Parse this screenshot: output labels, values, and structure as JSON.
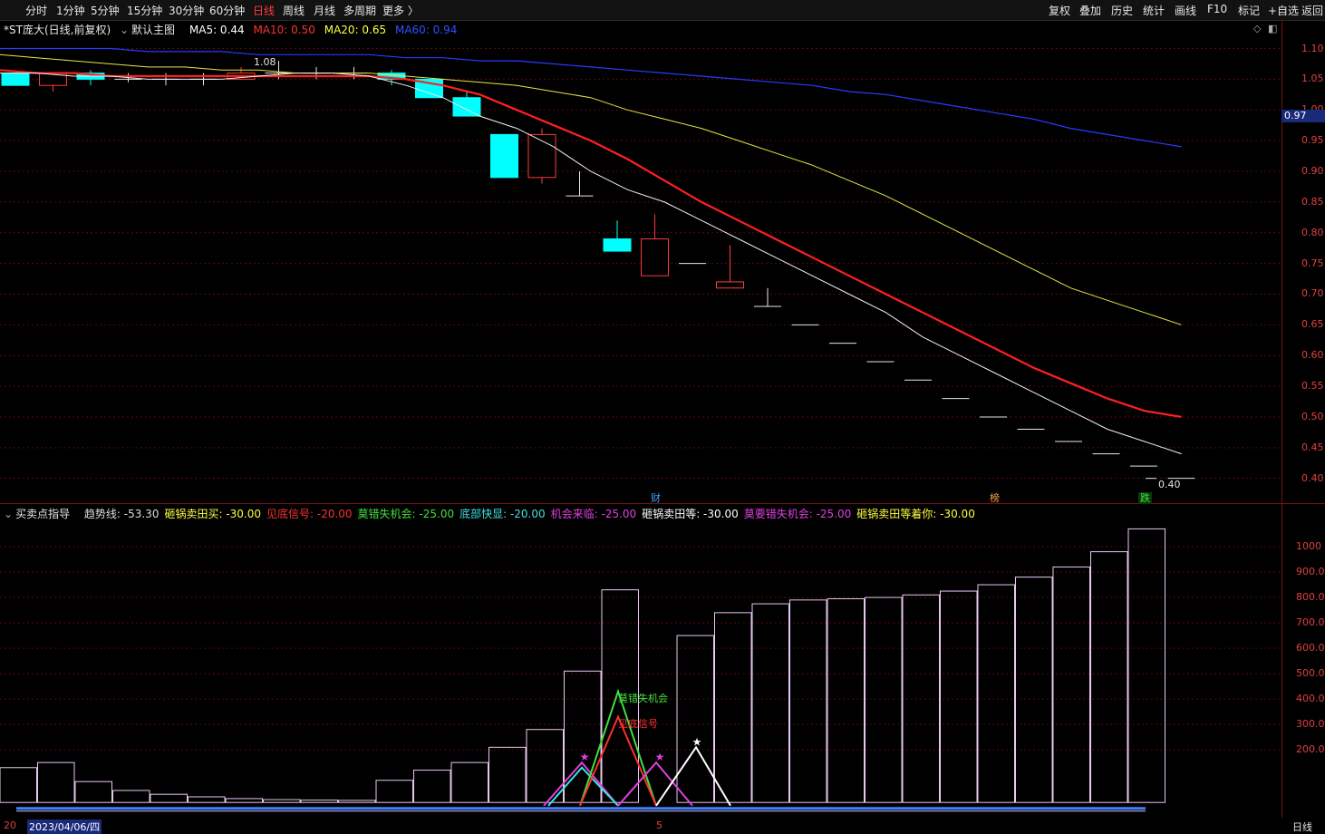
{
  "toolbar": {
    "periods": [
      "分时",
      "1分钟",
      "5分钟",
      "15分钟",
      "30分钟",
      "60分钟",
      "日线",
      "周线",
      "月线",
      "多周期",
      "更多 〉"
    ],
    "active_period": "日线",
    "right_buttons": [
      "复权",
      "叠加",
      "历史",
      "统计",
      "画线",
      "F10",
      "标记",
      "+自选",
      "返回"
    ]
  },
  "main": {
    "title": "*ST庞大(日线,前复权)",
    "indicator_toggle": "默认主图",
    "ma5_label": "MA5: 0.44",
    "ma10_label": "MA10: 0.50",
    "ma20_label": "MA20: 0.65",
    "ma60_label": "MA60: 0.94",
    "current_price_tag": "0.97",
    "high_annotation": "1.08",
    "low_annotation": "0.40",
    "events": {
      "cai": "财",
      "bang": "榜",
      "die": "跌"
    }
  },
  "sub": {
    "indicator_name": "买卖点指导",
    "items": [
      {
        "label": "趋势线: -53.30",
        "color": "#dddddd"
      },
      {
        "label": "砸锅卖田买: -30.00",
        "color": "#ffff40"
      },
      {
        "label": "见底信号: -20.00",
        "color": "#ff3030"
      },
      {
        "label": "莫错失机会: -25.00",
        "color": "#40e040"
      },
      {
        "label": "底部快显: -20.00",
        "color": "#40e0e0"
      },
      {
        "label": "机会来临: -25.00",
        "color": "#e040e0"
      },
      {
        "label": "砸锅卖田等: -30.00",
        "color": "#ffffff"
      },
      {
        "label": "莫要错失机会: -25.00",
        "color": "#e040e0"
      },
      {
        "label": "砸锅卖田等着你: -30.00",
        "color": "#ffff40"
      }
    ],
    "annot_green": "莫错失机会",
    "annot_red": "见底信号"
  },
  "axis": {
    "price_ticks": [
      "1.10",
      "1.05",
      "1.00",
      "0.95",
      "0.90",
      "0.85",
      "0.80",
      "0.75",
      "0.70",
      "0.65",
      "0.60",
      "0.55",
      "0.50",
      "0.45",
      "0.40"
    ],
    "sub_ticks": [
      "1000",
      "900.0",
      "800.0",
      "700.0",
      "600.0",
      "500.0",
      "400.0",
      "300.0",
      "200.0"
    ]
  },
  "bottom": {
    "date_label": "2023/04/06/四",
    "date_prefix": "20",
    "mid_marker": "5",
    "period_label": "日线"
  },
  "chart_data": {
    "type": "candlestick",
    "ylim": [
      0.37,
      1.12
    ],
    "candles": [
      {
        "o": 1.04,
        "c": 1.06,
        "h": 1.06,
        "l": 1.04,
        "up": false
      },
      {
        "o": 1.04,
        "c": 1.06,
        "h": 1.06,
        "l": 1.03,
        "up": true
      },
      {
        "o": 1.05,
        "c": 1.06,
        "h": 1.065,
        "l": 1.04,
        "up": false
      },
      {
        "o": 1.05,
        "c": 1.05,
        "h": 1.06,
        "l": 1.045,
        "up": true
      },
      {
        "o": 1.05,
        "c": 1.05,
        "h": 1.06,
        "l": 1.04,
        "up": true
      },
      {
        "o": 1.05,
        "c": 1.05,
        "h": 1.06,
        "l": 1.04,
        "up": true
      },
      {
        "o": 1.05,
        "c": 1.06,
        "h": 1.07,
        "l": 1.05,
        "up": true
      },
      {
        "o": 1.06,
        "c": 1.06,
        "h": 1.08,
        "l": 1.05,
        "up": true
      },
      {
        "o": 1.06,
        "c": 1.06,
        "h": 1.07,
        "l": 1.05,
        "up": true
      },
      {
        "o": 1.06,
        "c": 1.06,
        "h": 1.07,
        "l": 1.05,
        "up": true
      },
      {
        "o": 1.06,
        "c": 1.05,
        "h": 1.065,
        "l": 1.04,
        "up": false
      },
      {
        "o": 1.05,
        "c": 1.02,
        "h": 1.05,
        "l": 1.02,
        "up": false
      },
      {
        "o": 1.02,
        "c": 0.99,
        "h": 1.03,
        "l": 0.99,
        "up": false
      },
      {
        "o": 0.96,
        "c": 0.89,
        "h": 0.96,
        "l": 0.89,
        "up": false
      },
      {
        "o": 0.89,
        "c": 0.96,
        "h": 0.97,
        "l": 0.88,
        "up": true
      },
      {
        "o": 0.86,
        "c": 0.86,
        "h": 0.9,
        "l": 0.86,
        "up": true
      },
      {
        "o": 0.79,
        "c": 0.77,
        "h": 0.82,
        "l": 0.77,
        "up": false
      },
      {
        "o": 0.73,
        "c": 0.79,
        "h": 0.83,
        "l": 0.73,
        "up": true
      },
      {
        "o": 0.75,
        "c": 0.75,
        "h": 0.75,
        "l": 0.75,
        "up": true
      },
      {
        "o": 0.71,
        "c": 0.72,
        "h": 0.78,
        "l": 0.71,
        "up": true
      },
      {
        "o": 0.68,
        "c": 0.68,
        "h": 0.71,
        "l": 0.68,
        "up": true
      },
      {
        "o": 0.65,
        "c": 0.65,
        "h": 0.65,
        "l": 0.65,
        "up": true
      },
      {
        "o": 0.62,
        "c": 0.62,
        "h": 0.62,
        "l": 0.62,
        "up": true
      },
      {
        "o": 0.59,
        "c": 0.59,
        "h": 0.59,
        "l": 0.59,
        "up": true
      },
      {
        "o": 0.56,
        "c": 0.56,
        "h": 0.56,
        "l": 0.56,
        "up": true
      },
      {
        "o": 0.53,
        "c": 0.53,
        "h": 0.53,
        "l": 0.53,
        "up": true
      },
      {
        "o": 0.5,
        "c": 0.5,
        "h": 0.5,
        "l": 0.5,
        "up": true
      },
      {
        "o": 0.48,
        "c": 0.48,
        "h": 0.48,
        "l": 0.48,
        "up": true
      },
      {
        "o": 0.46,
        "c": 0.46,
        "h": 0.46,
        "l": 0.46,
        "up": true
      },
      {
        "o": 0.44,
        "c": 0.44,
        "h": 0.44,
        "l": 0.44,
        "up": true
      },
      {
        "o": 0.42,
        "c": 0.42,
        "h": 0.42,
        "l": 0.42,
        "up": true
      },
      {
        "o": 0.4,
        "c": 0.4,
        "h": 0.4,
        "l": 0.4,
        "up": true
      }
    ],
    "ma5": [
      1.06,
      1.06,
      1.055,
      1.055,
      1.05,
      1.05,
      1.05,
      1.055,
      1.06,
      1.06,
      1.055,
      1.04,
      1.02,
      0.99,
      0.97,
      0.94,
      0.9,
      0.87,
      0.85,
      0.82,
      0.79,
      0.76,
      0.73,
      0.7,
      0.67,
      0.63,
      0.6,
      0.57,
      0.54,
      0.51,
      0.48,
      0.46,
      0.44
    ],
    "ma10": [
      1.065,
      1.06,
      1.06,
      1.055,
      1.055,
      1.055,
      1.055,
      1.055,
      1.055,
      1.055,
      1.055,
      1.05,
      1.04,
      1.025,
      1.0,
      0.975,
      0.95,
      0.92,
      0.885,
      0.85,
      0.82,
      0.79,
      0.76,
      0.73,
      0.7,
      0.67,
      0.64,
      0.61,
      0.58,
      0.555,
      0.53,
      0.51,
      0.5
    ],
    "ma20": [
      1.09,
      1.085,
      1.08,
      1.075,
      1.07,
      1.07,
      1.065,
      1.065,
      1.06,
      1.06,
      1.06,
      1.055,
      1.05,
      1.045,
      1.04,
      1.03,
      1.02,
      1.0,
      0.985,
      0.97,
      0.95,
      0.93,
      0.91,
      0.885,
      0.86,
      0.83,
      0.8,
      0.77,
      0.74,
      0.71,
      0.69,
      0.67,
      0.65
    ],
    "ma60": [
      1.1,
      1.1,
      1.1,
      1.1,
      1.095,
      1.095,
      1.095,
      1.09,
      1.09,
      1.09,
      1.09,
      1.085,
      1.085,
      1.08,
      1.08,
      1.075,
      1.07,
      1.065,
      1.06,
      1.055,
      1.05,
      1.045,
      1.04,
      1.03,
      1.025,
      1.015,
      1.005,
      0.995,
      0.985,
      0.97,
      0.96,
      0.95,
      0.94
    ],
    "sub_ylim": [
      -60,
      1100
    ],
    "sub_bars": [
      130,
      150,
      75,
      40,
      25,
      15,
      8,
      4,
      2,
      1,
      80,
      120,
      150,
      210,
      280,
      510,
      830,
      0,
      650,
      740,
      775,
      790,
      795,
      800,
      810,
      825,
      850,
      880,
      920,
      980,
      1070
    ],
    "trend_line": [
      -53.3,
      -53.3,
      -53.3,
      -53.3,
      -53.3,
      -53.3,
      -53.3,
      -53.3,
      -53.3,
      -53.3,
      -53.3,
      -53.3,
      -53.3,
      -53.3,
      -53.3,
      -53.3,
      -53.3,
      -53.3,
      -53.3,
      -53.3,
      -53.3,
      -53.3,
      -53.3,
      -53.3,
      -53.3,
      -53.3,
      -53.3,
      -53.3,
      -53.3,
      -53.3,
      -53.3
    ]
  }
}
